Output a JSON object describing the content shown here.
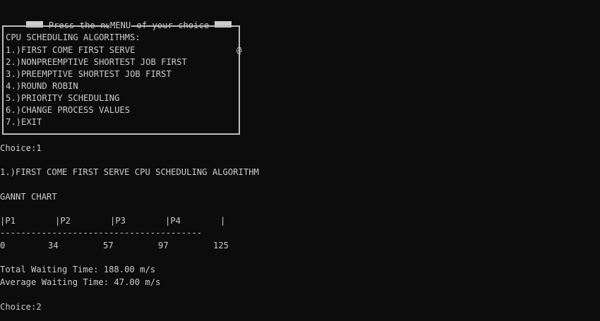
{
  "prompt": {
    "text": "Press the number of your choice"
  },
  "menu": {
    "title": "MENU",
    "heading": "CPU SCHEDULING ALGORITHMS:",
    "items": [
      {
        "label": "1.)FIRST COME FIRST SERVE"
      },
      {
        "label": "2.)NONPREEMPTIVE SHORTEST JOB FIRST"
      },
      {
        "label": "3.)PREEMPTIVE SHORTEST JOB FIRST"
      },
      {
        "label": "4.)ROUND ROBIN"
      },
      {
        "label": "5.)PRIORITY SCHEDULING"
      },
      {
        "label": "6.)CHANGE PROCESS VALUES"
      },
      {
        "label": "7.)EXIT"
      }
    ],
    "cursor_glyph": "@"
  },
  "output": {
    "choice1": "Choice:1",
    "algorithm_title": "1.)FIRST COME FIRST SERVE CPU SCHEDULING ALGORITHM",
    "gantt_title": "GANNT CHART",
    "gantt_processes": [
      "|P1",
      "|P2",
      "|P3",
      "|P4",
      "|"
    ],
    "gantt_separator": "---------------------------------------",
    "gantt_times": [
      "0",
      "34",
      "57",
      "97",
      "125"
    ],
    "total_waiting": "Total Waiting Time: 188.00 m/s",
    "average_waiting": "Average Waiting Time: 47.00 m/s",
    "choice2": "Choice:2"
  }
}
